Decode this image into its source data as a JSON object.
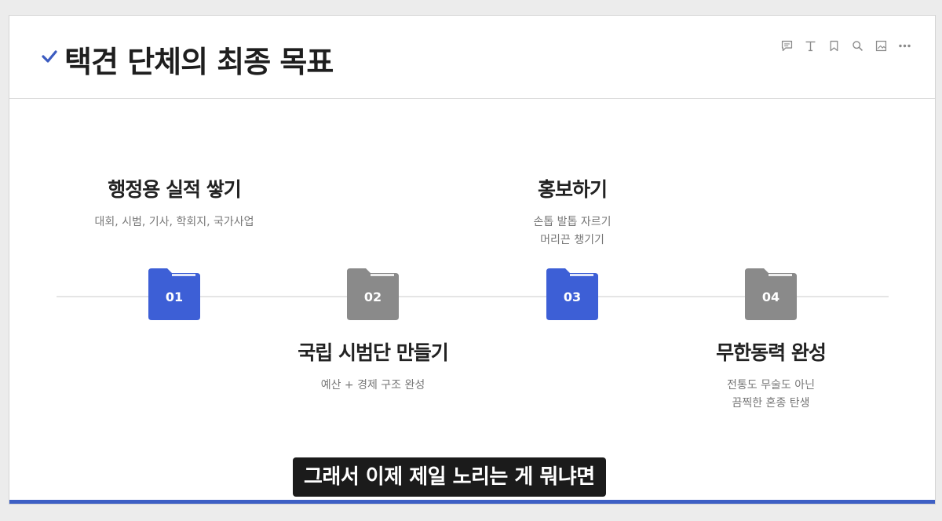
{
  "header": {
    "title": "택견 단체의 최종 목표",
    "toolbar": [
      "comment-icon",
      "text-icon",
      "bookmark-icon",
      "search-icon",
      "image-icon",
      "more-icon"
    ]
  },
  "steps": [
    {
      "number": "01",
      "title": "행정용 실적 쌓기",
      "desc": [
        "대회, 시범, 기사, 학회지, 국가사업"
      ],
      "folder_color": "#3d5fd6",
      "active": true
    },
    {
      "number": "02",
      "title": "국립 시범단 만들기",
      "desc": [
        "예산 + 경제 구조 완성"
      ],
      "folder_color": "#8a8a8a",
      "active": false
    },
    {
      "number": "03",
      "title": "홍보하기",
      "desc": [
        "손톱 발톱 자르기",
        "머리끈 챙기기"
      ],
      "folder_color": "#3d5fd6",
      "active": true
    },
    {
      "number": "04",
      "title": "무한동력 완성",
      "desc": [
        "전통도 무술도 아닌",
        "끔찍한 혼종 탄생"
      ],
      "folder_color": "#8a8a8a",
      "active": false
    }
  ],
  "caption": "그래서 이제 제일 노리는 게 뭐냐면",
  "colors": {
    "accent": "#3d5fc4",
    "folder_active": "#3d5fd6",
    "folder_inactive": "#8a8a8a"
  }
}
